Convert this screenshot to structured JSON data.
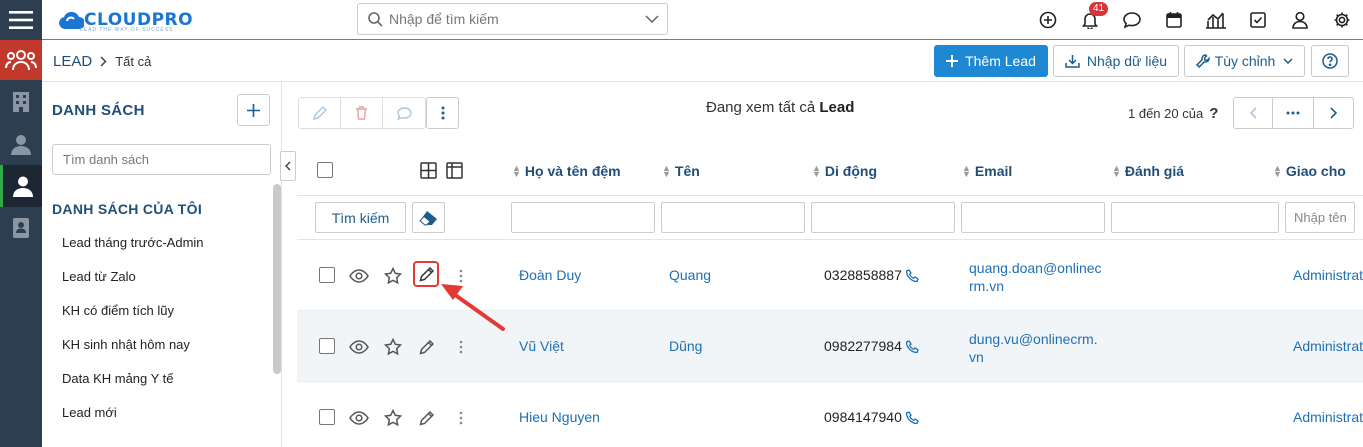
{
  "header": {
    "logo_text": "CLOUDPRO",
    "logo_tagline": "LEAD THE WAY OF SUCCESS",
    "search_placeholder": "Nhập để tìm kiếm",
    "notification_count": "41"
  },
  "breadcrumb": {
    "module": "LEAD",
    "current": "Tất cả"
  },
  "actions": {
    "add_label": "Thêm Lead",
    "import_label": "Nhập dữ liệu",
    "customize_label": "Tùy chỉnh"
  },
  "list_panel": {
    "title": "DANH SÁCH",
    "search_placeholder": "Tìm danh sách",
    "section_title": "DANH SÁCH CỦA TÔI",
    "items": [
      "Lead tháng trước-Admin",
      "Lead từ Zalo",
      "KH có điểm tích lũy",
      "KH sinh nhật hôm nay",
      "Data KH mảng Y tế",
      "Lead mới"
    ]
  },
  "main": {
    "viewing_prefix": "Đang xem tất cả",
    "viewing_module": "Lead",
    "paging_text": "1 đến 20 của",
    "paging_unknown": "?",
    "search_button": "Tìm kiếm",
    "last_filter_placeholder": "Nhập tên"
  },
  "table": {
    "columns": [
      "Họ và tên đệm",
      "Tên",
      "Di động",
      "Email",
      "Đánh giá",
      "Giao cho"
    ],
    "rows": [
      {
        "last_name": "Đoàn Duy",
        "first_name": "Quang",
        "mobile": "0328858887",
        "email": "quang.doan@onlinecrm.vn",
        "rating": "",
        "assigned": "Administrator"
      },
      {
        "last_name": "Vũ Việt",
        "first_name": "Dũng",
        "mobile": "0982277984",
        "email": "dung.vu@onlinecrm.vn",
        "rating": "",
        "assigned": "Administrator"
      },
      {
        "last_name": "Hieu Nguyen",
        "first_name": "",
        "mobile": "0984147940",
        "email": "",
        "rating": "",
        "assigned": "Administrator"
      }
    ]
  },
  "colors": {
    "primary": "#1e88d2",
    "nav": "#2d3e50",
    "nav_active": "#c0392b",
    "link": "#1e6fb5",
    "annotation": "#e53935"
  }
}
